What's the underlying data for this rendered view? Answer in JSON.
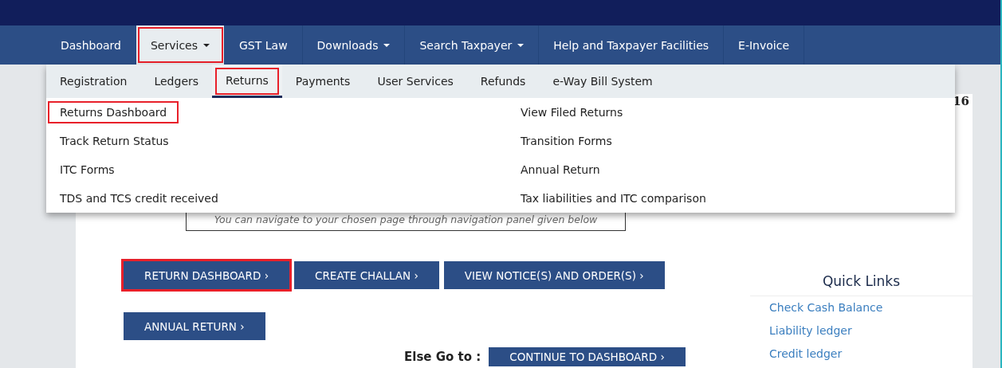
{
  "top_nav": [
    {
      "label": "Dashboard",
      "selected": false,
      "has_caret": false,
      "highlighted": false
    },
    {
      "label": "Services",
      "selected": true,
      "has_caret": true,
      "highlighted": true
    },
    {
      "label": "GST Law",
      "selected": false,
      "has_caret": false,
      "highlighted": false
    },
    {
      "label": "Downloads",
      "selected": false,
      "has_caret": true,
      "highlighted": false
    },
    {
      "label": "Search Taxpayer",
      "selected": false,
      "has_caret": true,
      "highlighted": false
    },
    {
      "label": "Help and Taxpayer Facilities",
      "selected": false,
      "has_caret": false,
      "highlighted": false
    },
    {
      "label": "E-Invoice",
      "selected": false,
      "has_caret": false,
      "highlighted": false
    }
  ],
  "submenu": [
    {
      "label": "Registration",
      "selected": false,
      "highlighted": false
    },
    {
      "label": "Ledgers",
      "selected": false,
      "highlighted": false
    },
    {
      "label": "Returns",
      "selected": true,
      "highlighted": true
    },
    {
      "label": "Payments",
      "selected": false,
      "highlighted": false
    },
    {
      "label": "User Services",
      "selected": false,
      "highlighted": false
    },
    {
      "label": "Refunds",
      "selected": false,
      "highlighted": false
    },
    {
      "label": "e-Way Bill System",
      "selected": false,
      "highlighted": false
    }
  ],
  "menu_columns": [
    [
      {
        "label": "Returns Dashboard",
        "highlighted": true
      },
      {
        "label": "Track Return Status",
        "highlighted": false
      },
      {
        "label": "ITC Forms",
        "highlighted": false
      },
      {
        "label": "TDS and TCS credit received",
        "highlighted": false
      }
    ],
    [
      {
        "label": "View Filed Returns",
        "highlighted": false
      },
      {
        "label": "Transition Forms",
        "highlighted": false
      },
      {
        "label": "Annual Return",
        "highlighted": false
      },
      {
        "label": "Tax liabilities and ITC comparison",
        "highlighted": false
      }
    ]
  ],
  "corner_text": "16",
  "hint": "You can navigate to your chosen page through navigation panel given below",
  "button_rows": [
    [
      {
        "label": "RETURN DASHBOARD ›",
        "highlighted": true
      },
      {
        "label": "CREATE CHALLAN ›",
        "highlighted": false
      },
      {
        "label": "VIEW NOTICE(S) AND ORDER(S) ›",
        "highlighted": false
      }
    ],
    [
      {
        "label": "ANNUAL RETURN ›",
        "highlighted": false
      }
    ]
  ],
  "else_go_to": "Else Go to :",
  "continue_button": "CONTINUE TO DASHBOARD ›",
  "quick_links": {
    "title": "Quick Links",
    "links": [
      "Check Cash Balance",
      "Liability ledger",
      "Credit ledger"
    ]
  }
}
